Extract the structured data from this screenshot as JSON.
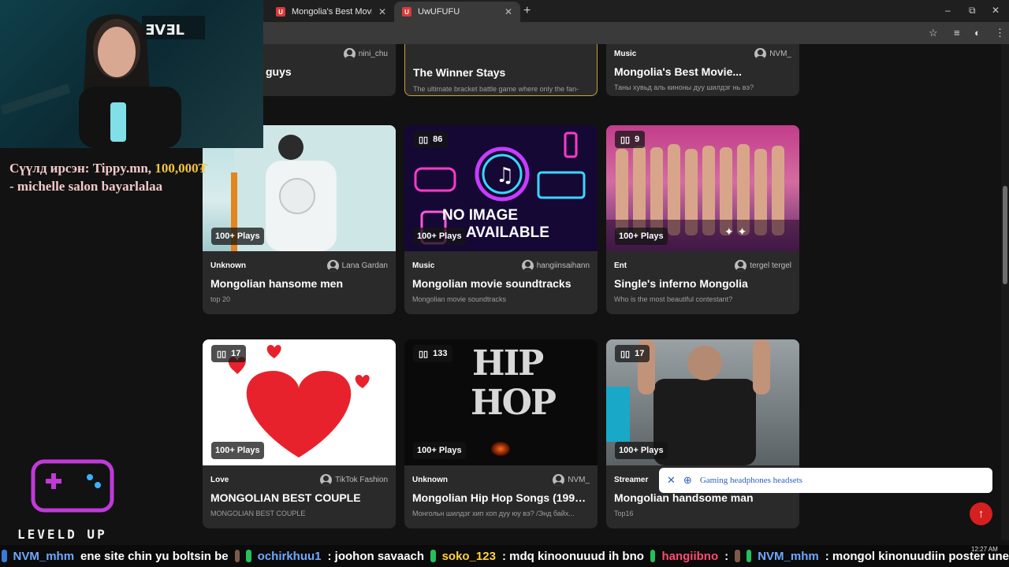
{
  "browser": {
    "tabs": [
      {
        "title": "Mongolia's Best Movie Soundt",
        "favicon": "U"
      },
      {
        "title": "UwUFUFU",
        "favicon": "U"
      }
    ]
  },
  "top_cards": [
    {
      "category": "",
      "author": "nini_chu",
      "title": "guys",
      "desc": ""
    },
    {
      "category": "",
      "author": "",
      "title": "The Winner Stays",
      "desc": "The ultimate bracket battle game where only the fan-favorite choice survives — you decide who wins,..."
    },
    {
      "category": "Music",
      "author": "NVM_",
      "title": "Mongolia's Best Movie...",
      "desc": "Таны хувьд аль киноны дуу шилдэг нь вэ?"
    }
  ],
  "cards": [
    {
      "count": "",
      "plays": "100+ Plays",
      "category": "Unknown",
      "author": "Lana Gardan",
      "title": "Mongolian hansome men",
      "desc": "top 20"
    },
    {
      "count": "86",
      "plays": "100+ Plays",
      "category": "Music",
      "author": "hangiinsaihann",
      "title": "Mongolian movie soundtracks",
      "desc": "Mongolian movie soundtracks",
      "thumb_text_1": "NO IMAGE",
      "thumb_text_2": "AVAILABLE"
    },
    {
      "count": "9",
      "plays": "100+ Plays",
      "category": "Ent",
      "author": "tergel tergel",
      "title": "Single's inferno Mongolia",
      "desc": "Who is the most beautiful contestant?"
    },
    {
      "count": "17",
      "plays": "100+ Plays",
      "category": "Love",
      "author": "TikTok Fashion",
      "title": "MONGOLIAN BEST COUPLE",
      "desc": "MONGOLIAN BEST COUPLE"
    },
    {
      "count": "133",
      "plays": "100+ Plays",
      "category": "Unknown",
      "author": "NVM_",
      "title": "Mongolian Hip Hop Songs (1997-...",
      "desc": "Монгольн шилдэг хип хоп дуу юу вэ? /Энд байх...",
      "thumb_text_1": "HIP",
      "thumb_text_2": "HOP"
    },
    {
      "count": "17",
      "plays": "100+ Plays",
      "category": "Streamer",
      "author": "",
      "title": "Mongolian handsome man",
      "desc": "Top16"
    }
  ],
  "overlay": {
    "donation_prefix": "Сүүлд ирсэн: Tippy.mn, ",
    "donation_amount": "100,000₮",
    "donation_line2": "- michelle salon bayarlalaa",
    "logo_text": "LEVELD UP",
    "search_suggestion": "Gaming headphones headsets",
    "ticker": [
      {
        "user": "NVM_mhm",
        "msg": "ene site chin yu boltsin be"
      },
      {
        "user": "ochirkhuu1",
        "msg": ": joohon savaach"
      },
      {
        "user": "soko_123",
        "msg": ": mdq kinoonuuud ih bno"
      },
      {
        "user": "hangiibno",
        "msg": ":"
      },
      {
        "user": "NVM_mhm",
        "msg": ": mongol kinonuudiin poster une"
      }
    ],
    "clock": "12:27 AM"
  },
  "colors": {
    "accent": "#d62020",
    "highlight_border": "#c8a23a",
    "card_bg": "#2a2a2a",
    "page_bg": "#121212"
  }
}
